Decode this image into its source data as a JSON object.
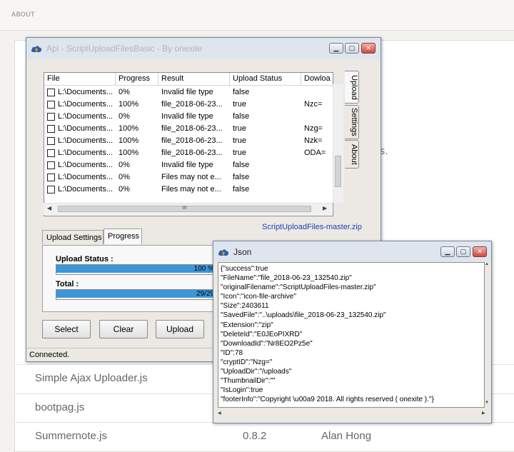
{
  "background": {
    "top_label": "ABOUT",
    "side_fragment": "s.",
    "rows": [
      {
        "name": "Simple Ajax Uploader.js",
        "version": "",
        "author": ""
      },
      {
        "name": "bootpag.js",
        "version": "",
        "author": ""
      },
      {
        "name": "Summernote.js",
        "version": "0.8.2",
        "author": "Alan Hong"
      }
    ]
  },
  "main_window": {
    "title": "Api  - ScriptUploadFilesBasic - By onexite",
    "columns": [
      "File",
      "Progress",
      "Result",
      "Upload Status",
      "Dowloa"
    ],
    "rows": [
      {
        "file": "L:\\Documents...",
        "progress": "0%",
        "result": "Invalid file type",
        "status": "false",
        "download": ""
      },
      {
        "file": "L:\\Documents...",
        "progress": "100%",
        "result": "file_2018-06-23...",
        "status": "true",
        "download": "Nzc="
      },
      {
        "file": "L:\\Documents...",
        "progress": "0%",
        "result": "Invalid file type",
        "status": "false",
        "download": ""
      },
      {
        "file": "L:\\Documents...",
        "progress": "100%",
        "result": "file_2018-06-23...",
        "status": "true",
        "download": "Nzg="
      },
      {
        "file": "L:\\Documents...",
        "progress": "100%",
        "result": "file_2018-06-23...",
        "status": "true",
        "download": "Nzk="
      },
      {
        "file": "L:\\Documents...",
        "progress": "100%",
        "result": "file_2018-06-23...",
        "status": "true",
        "download": "ODA="
      },
      {
        "file": "L:\\Documents...",
        "progress": "0%",
        "result": "Invalid file type",
        "status": "false",
        "download": ""
      },
      {
        "file": "L:\\Documents...",
        "progress": "0%",
        "result": "Files may not e...",
        "status": "false",
        "download": ""
      },
      {
        "file": "L:\\Documents...",
        "progress": "0%",
        "result": "Files may not e...",
        "status": "false",
        "download": ""
      }
    ],
    "hscroll_grip": "III",
    "side_tabs": [
      "Upload",
      "Settings",
      "About"
    ],
    "link": "ScriptUploadFiles-master.zip",
    "tabs": [
      "Upload Settings",
      "Progress"
    ],
    "active_tab": "Progress",
    "upload_status_label": "Upload Status :",
    "upload_status_text": "100 %",
    "upload_status_fraction": 1.0,
    "total_label": "Total :",
    "total_text": "29/29",
    "total_fraction": 1.0,
    "buttons": {
      "select": "Select",
      "clear": "Clear",
      "upload": "Upload"
    },
    "status_text": "Connected.",
    "accent_color": "#3c96d8"
  },
  "json_window": {
    "title": "Json",
    "lines": [
      "{\"success\":true",
      "\"FileName\":\"file_2018-06-23_132540.zip\"",
      "\"originalFilename\":\"ScriptUploadFiles-master.zip\"",
      "\"Icon\":\"icon-file-archive\"",
      "\"Size\":2403611",
      "\"SavedFile\":\"..\\uploads\\file_2018-06-23_132540.zip\"",
      "\"Extension\":\"zip\"",
      "\"DeleteId\":\"E0JEoPIXRD\"",
      "\"DownloadId\":\"Nr8EO2Pz5e\"",
      "\"ID\":78",
      "\"cryptID\":\"Nzg=\"",
      "\"UploadDir\":\"/uploads\"",
      "\"ThumbnailDir\":\"\"",
      "\"IsLogin\":true",
      "\"footerInfo\":\"Copyright \\u00a9 2018. All rights reserved ( onexite ).\"}"
    ]
  }
}
